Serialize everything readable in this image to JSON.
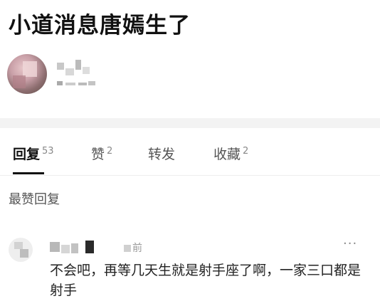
{
  "post": {
    "title": "小道消息唐嫣生了"
  },
  "tabs": [
    {
      "label": "回复",
      "count": "53"
    },
    {
      "label": "赞",
      "count": "2"
    },
    {
      "label": "转发",
      "count": ""
    },
    {
      "label": "收藏",
      "count": "2"
    }
  ],
  "hot_replies": {
    "title": "最赞回复"
  },
  "comment": {
    "time_suffix": "前",
    "more_icon": "···",
    "text": "不会吧，再等几天生就是射手座了啊，一家三口都是射手"
  }
}
